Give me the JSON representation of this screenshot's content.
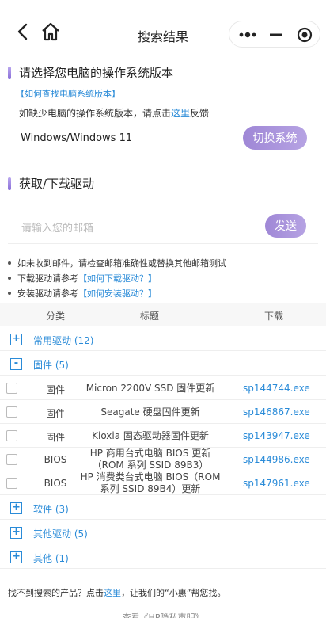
{
  "nav": {
    "title": "搜索结果"
  },
  "os_section": {
    "title": "请选择您电脑的操作系统版本",
    "how_link": "【如何查找电脑系统版本】",
    "missing_prefix": "如缺少电脑的操作系统版本，请点击",
    "missing_link": "这里",
    "missing_suffix": "反馈",
    "current_os": "Windows/Windows 11",
    "switch_button": "切换系统"
  },
  "driver_section": {
    "title": "获取/下载驱动",
    "email_placeholder": "请输入您的邮箱",
    "send_button": "发送",
    "bullets": [
      {
        "text": "如未收到邮件，请检查邮箱准确性或替换其他邮箱测试",
        "link": ""
      },
      {
        "text": "下载驱动请参考",
        "link": "【如何下载驱动？】"
      },
      {
        "text": "安装驱动请参考",
        "link": "【如何安装驱动？】"
      }
    ]
  },
  "table": {
    "headers": {
      "category": "分类",
      "title": "标题",
      "download": "下载"
    },
    "groups": [
      {
        "label": "常用驱动 (12)",
        "toggle": "+"
      },
      {
        "label": "固件 (5)",
        "toggle": "-"
      },
      {
        "label": "软件 (3)",
        "toggle": "+"
      },
      {
        "label": "其他驱动 (5)",
        "toggle": "+"
      },
      {
        "label": "其他 (1)",
        "toggle": "+"
      }
    ],
    "rows": [
      {
        "category": "固件",
        "title": "Micron 2200V SSD 固件更新",
        "download": "sp144744.exe"
      },
      {
        "category": "固件",
        "title": "Seagate 硬盘固件更新",
        "download": "sp146867.exe"
      },
      {
        "category": "固件",
        "title": "Kioxia 固态驱动器固件更新",
        "download": "sp143947.exe"
      },
      {
        "category": "BIOS",
        "title": "HP 商用台式电脑 BIOS 更新 （ROM 系列 SSID 89B3）",
        "download": "sp144986.exe"
      },
      {
        "category": "BIOS",
        "title": "HP 消费类台式电脑 BIOS（ROM 系列 SSID 89B4）更新",
        "download": "sp147961.exe"
      }
    ]
  },
  "footer": {
    "prefix": "找不到搜索的产品？点击",
    "link": "这里",
    "suffix": "，让我们的“小惠”帮您找。",
    "cut_text": "查看《HP隐私声明》"
  },
  "colors": {
    "accent_purple": "#9f87d6",
    "link_blue": "#2a8bd8"
  }
}
